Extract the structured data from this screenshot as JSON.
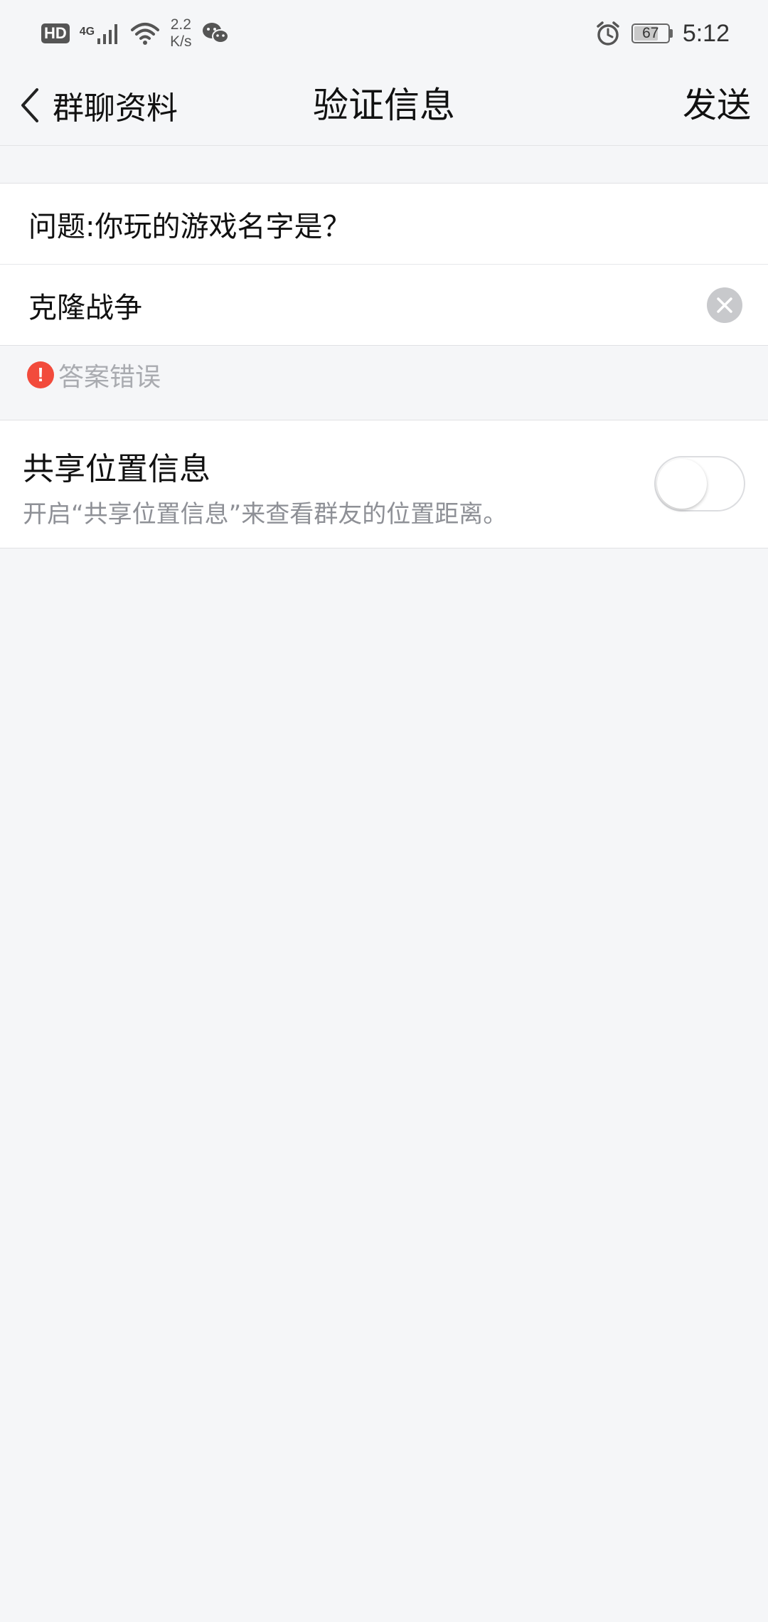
{
  "status_bar": {
    "hd_label": "HD",
    "network_type": "4G",
    "speed_value": "2.2",
    "speed_unit": "K/s",
    "battery_level": "67",
    "time": "5:12",
    "icons": [
      "hd-badge",
      "signal-icon",
      "wifi-icon",
      "wechat-icon",
      "alarm-icon",
      "battery-icon"
    ]
  },
  "nav": {
    "back_label": "群聊资料",
    "title": "验证信息",
    "send_label": "发送"
  },
  "form": {
    "question": "问题:你玩的游戏名字是？",
    "answer_value": "克隆战争",
    "error_text": "答案错误",
    "error_color": "#f24b3c"
  },
  "share_location": {
    "title": "共享位置信息",
    "description": "开启“共享位置信息”来查看群友的位置距离。",
    "enabled": false
  }
}
